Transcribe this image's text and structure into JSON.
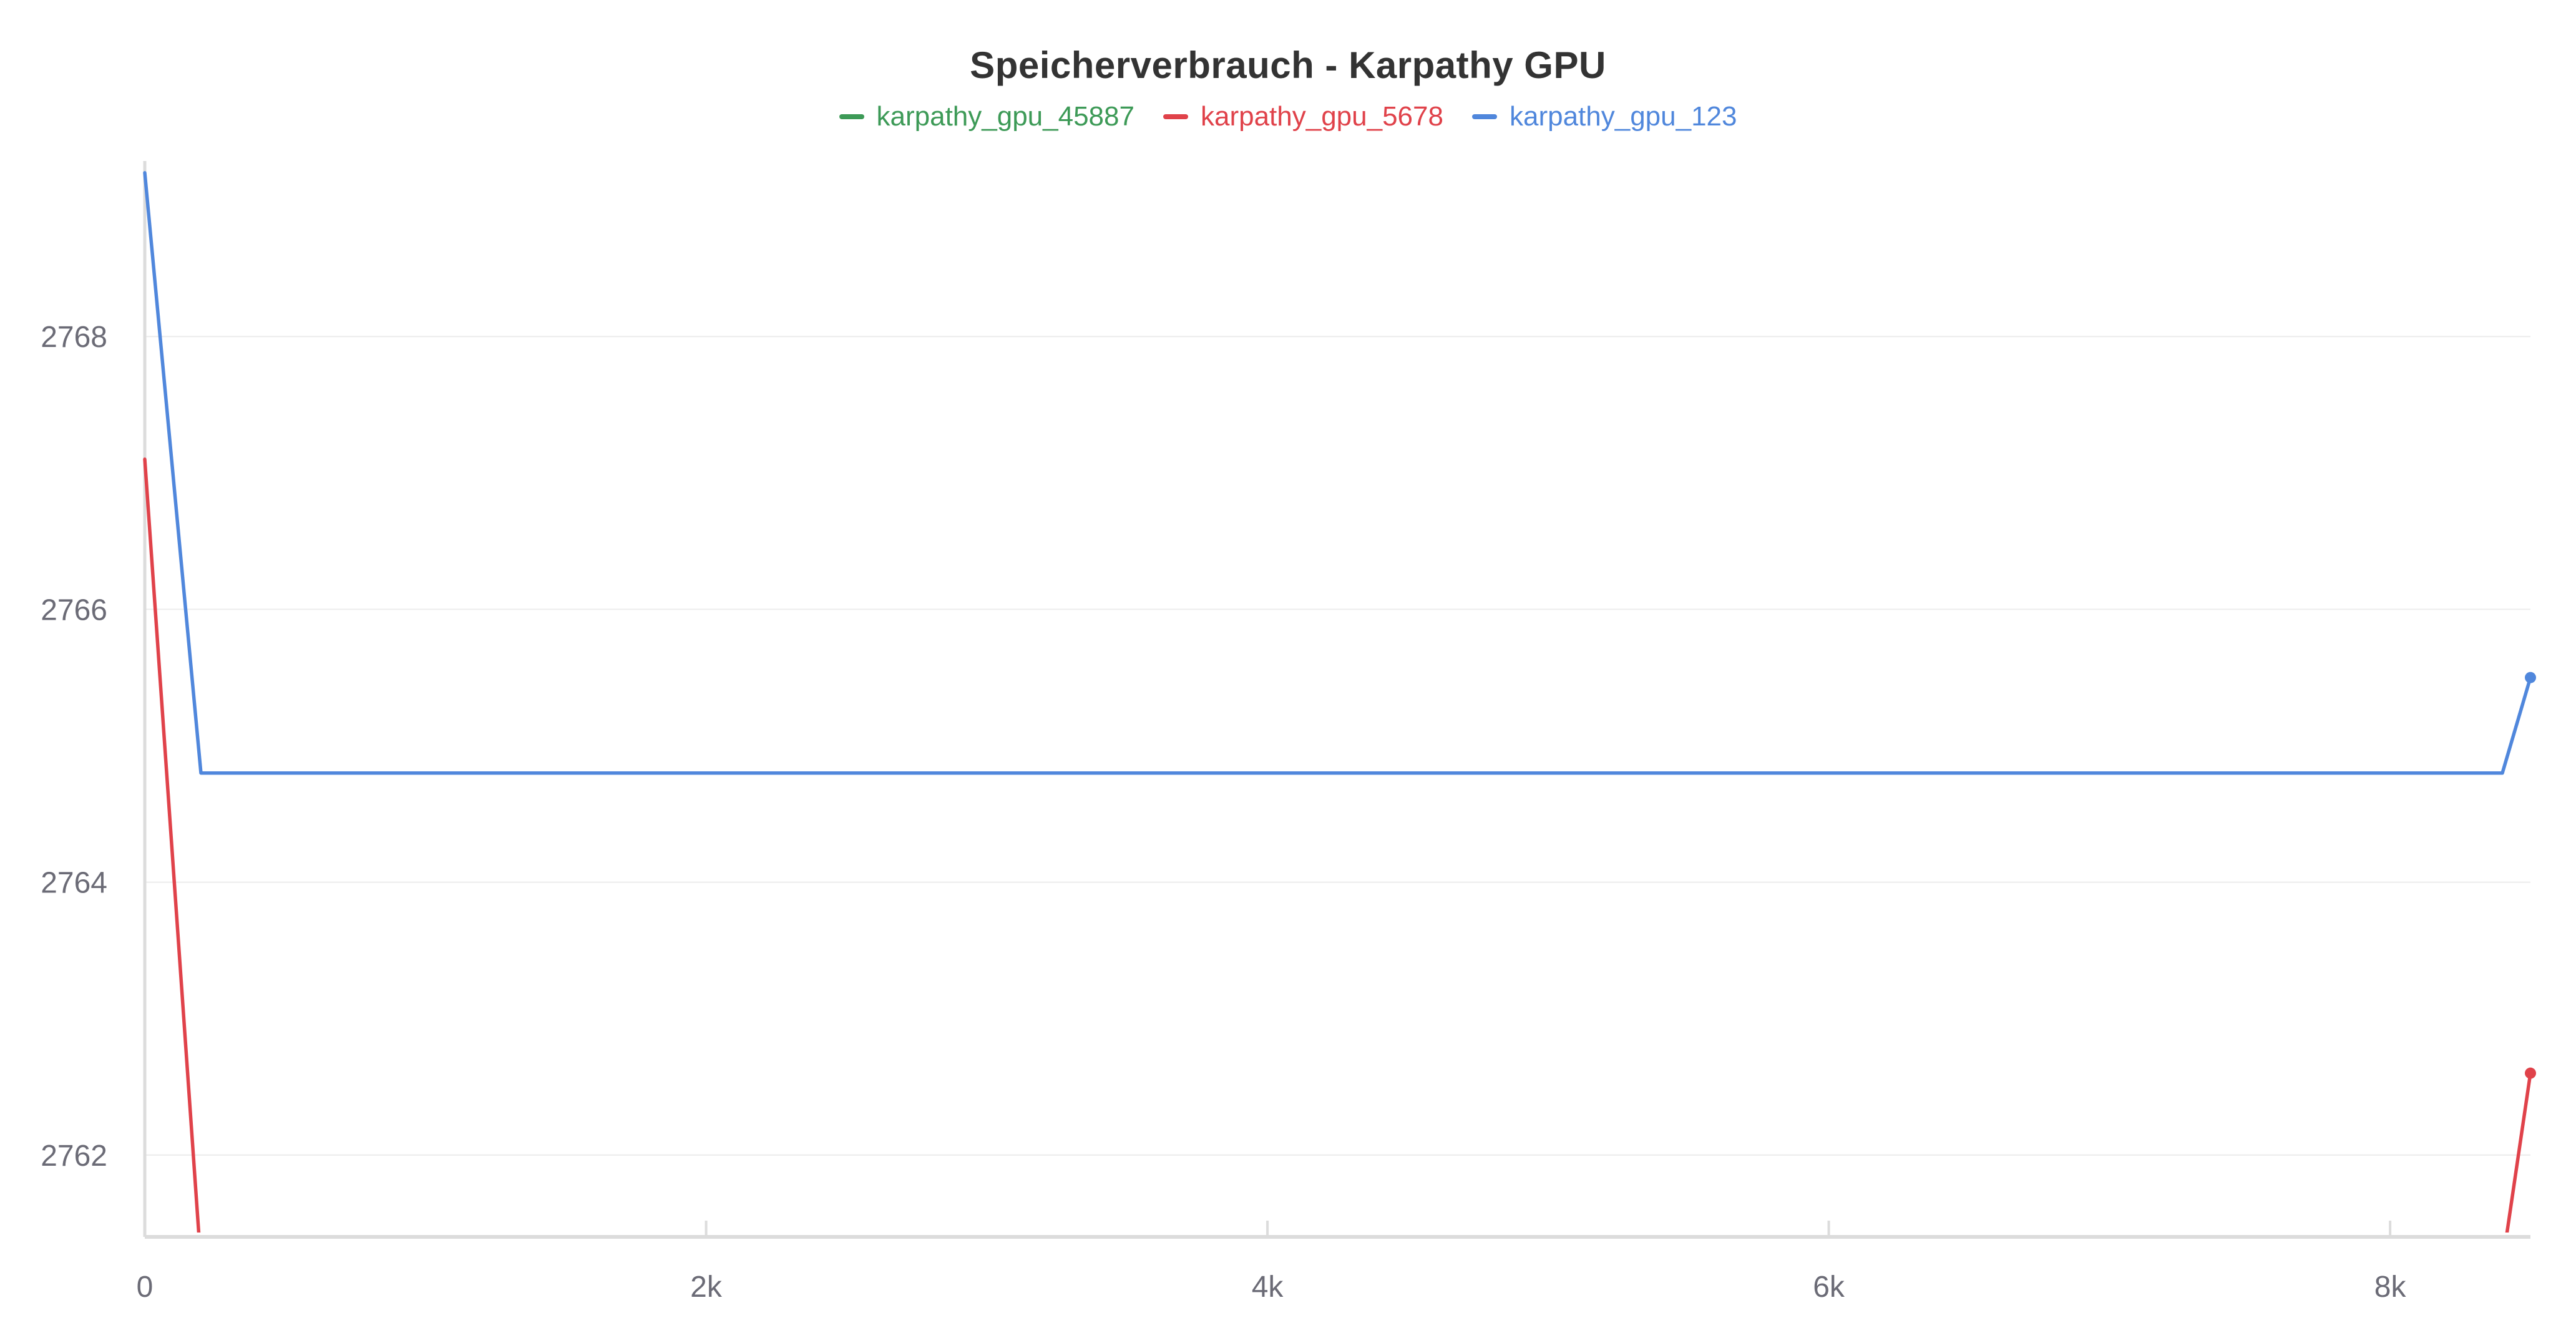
{
  "chart_data": {
    "type": "line",
    "title": "Speicherverbrauch - Karpathy GPU",
    "xlabel": "",
    "ylabel": "",
    "xlim": [
      0,
      8500
    ],
    "ylim": [
      2761.4,
      2769.3
    ],
    "x_ticks": [
      0,
      2000,
      4000,
      6000,
      8000
    ],
    "x_tick_labels": [
      "0",
      "2k",
      "4k",
      "6k",
      "8k"
    ],
    "y_ticks": [
      2762,
      2764,
      2766,
      2768
    ],
    "y_tick_labels": [
      "2762",
      "2764",
      "2766",
      "2768"
    ],
    "grid": true,
    "legend_position": "top-center",
    "series": [
      {
        "name": "karpathy_gpu_45887",
        "color": "#3d9a57",
        "x": [],
        "y": []
      },
      {
        "name": "karpathy_gpu_5678",
        "color": "#e0424a",
        "x": [
          0,
          200,
          8400,
          8500
        ],
        "y": [
          2767.1,
          2761.2,
          2761.2,
          2762.6
        ]
      },
      {
        "name": "karpathy_gpu_123",
        "color": "#5087dc",
        "x": [
          0,
          200,
          8400,
          8500
        ],
        "y": [
          2769.2,
          2764.8,
          2764.8,
          2765.5
        ]
      }
    ]
  }
}
